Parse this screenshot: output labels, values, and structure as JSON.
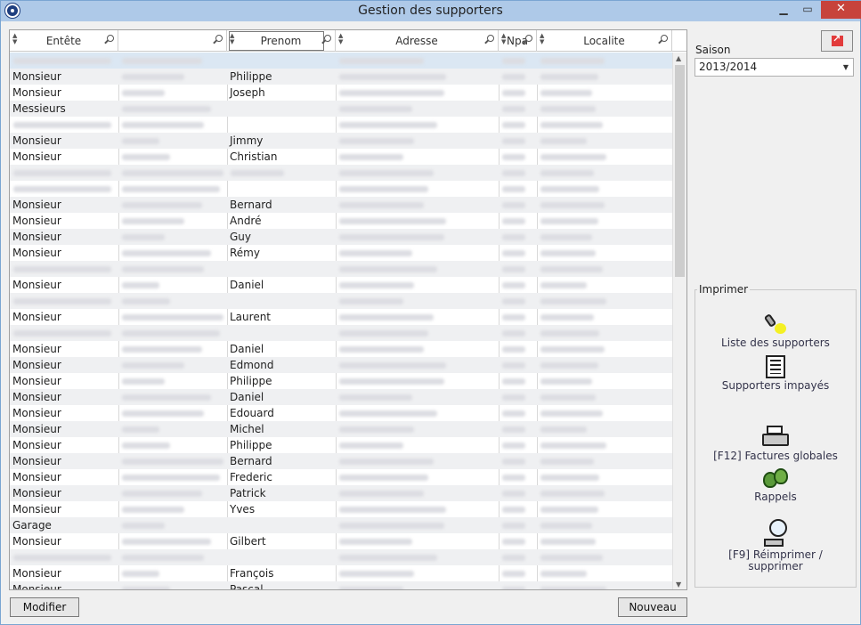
{
  "window": {
    "title": "Gestion des supporters"
  },
  "columns": [
    {
      "name": "col-entete",
      "label": "Entête"
    },
    {
      "name": "col-nom",
      "label": ""
    },
    {
      "name": "col-prenom",
      "label": "Prenom"
    },
    {
      "name": "col-adresse",
      "label": "Adresse"
    },
    {
      "name": "col-npa",
      "label": "Npa"
    },
    {
      "name": "col-localite",
      "label": "Localite"
    }
  ],
  "rows": [
    {
      "entete": "",
      "prenom": ""
    },
    {
      "entete": "Monsieur",
      "prenom": "Philippe"
    },
    {
      "entete": "Monsieur",
      "prenom": "Joseph"
    },
    {
      "entete": "Messieurs",
      "prenom": ""
    },
    {
      "entete": "",
      "prenom": ""
    },
    {
      "entete": "Monsieur",
      "prenom": "Jimmy"
    },
    {
      "entete": "Monsieur",
      "prenom": "Christian"
    },
    {
      "entete": "",
      "prenom": ""
    },
    {
      "entete": "",
      "prenom": ""
    },
    {
      "entete": "Monsieur",
      "prenom": "Bernard"
    },
    {
      "entete": "Monsieur",
      "prenom": "André"
    },
    {
      "entete": "Monsieur",
      "prenom": "Guy"
    },
    {
      "entete": "Monsieur",
      "prenom": "Rémy"
    },
    {
      "entete": "",
      "prenom": ""
    },
    {
      "entete": "Monsieur",
      "prenom": "Daniel"
    },
    {
      "entete": "",
      "prenom": ""
    },
    {
      "entete": "Monsieur",
      "prenom": "Laurent"
    },
    {
      "entete": "",
      "prenom": ""
    },
    {
      "entete": "Monsieur",
      "prenom": "Daniel"
    },
    {
      "entete": "Monsieur",
      "prenom": "Edmond"
    },
    {
      "entete": "Monsieur",
      "prenom": "Philippe"
    },
    {
      "entete": "Monsieur",
      "prenom": "Daniel"
    },
    {
      "entete": "Monsieur",
      "prenom": "Edouard"
    },
    {
      "entete": "Monsieur",
      "prenom": "Michel"
    },
    {
      "entete": "Monsieur",
      "prenom": "Philippe"
    },
    {
      "entete": "Monsieur",
      "prenom": "Bernard"
    },
    {
      "entete": "Monsieur",
      "prenom": "Frederic"
    },
    {
      "entete": "Monsieur",
      "prenom": "Patrick"
    },
    {
      "entete": "Monsieur",
      "prenom": "Yves"
    },
    {
      "entete": "Garage",
      "prenom": ""
    },
    {
      "entete": "Monsieur",
      "prenom": "Gilbert"
    },
    {
      "entete": "",
      "prenom": ""
    },
    {
      "entete": "Monsieur",
      "prenom": "François"
    },
    {
      "entete": "Monsieur",
      "prenom": "Pascal"
    }
  ],
  "saison": {
    "label": "Saison",
    "value": "2013/2014"
  },
  "imprimer": {
    "label": "Imprimer",
    "liste": "Liste des supporters",
    "impayes": "Supporters impayés",
    "factures": "[F12] Factures globales",
    "rappels": "Rappels",
    "reimprimer1": "[F9] Réimprimer /",
    "reimprimer2": "supprimer"
  },
  "buttons": {
    "modifier": "Modifier",
    "nouveau": "Nouveau"
  },
  "icons": {
    "app": "app-logo-icon",
    "export": "export-arrow-icon",
    "liste": "flashlight-icon",
    "impayes": "document-list-icon",
    "factures": "printer-icon",
    "rappels": "money-bag-icon",
    "reimprimer": "magnifier-printer-icon"
  }
}
